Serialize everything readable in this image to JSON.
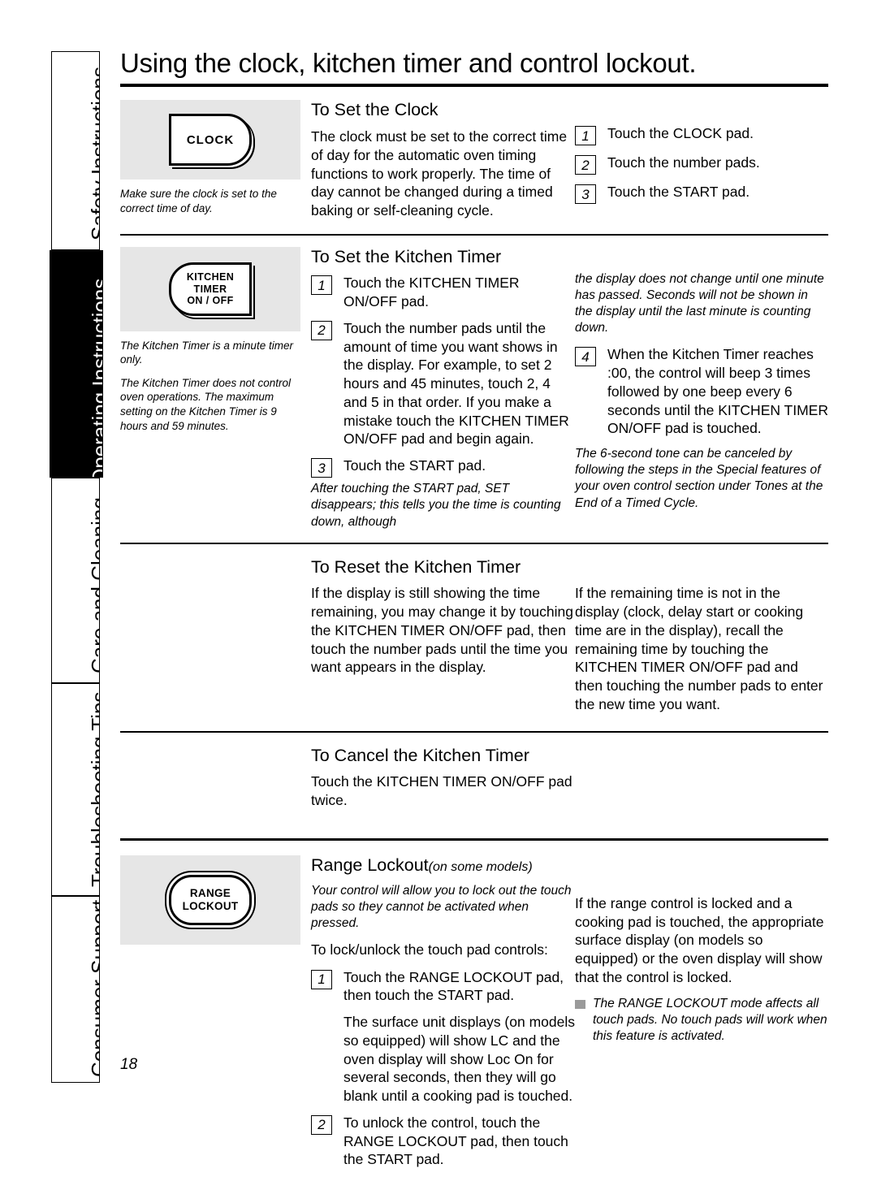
{
  "sidebar": {
    "tabs": [
      {
        "label": "Safety Instructions",
        "active": false
      },
      {
        "label": "Operating Instructions",
        "active": true
      },
      {
        "label": "Care and Cleaning",
        "active": false
      },
      {
        "label": "Troubleshooting Tips",
        "active": false
      },
      {
        "label": "Consumer Support",
        "active": false
      }
    ]
  },
  "page": {
    "title": "Using the clock, kitchen timer and control lockout.",
    "number": "18"
  },
  "clock_section": {
    "pad_label_line1": "CLOCK",
    "heading": "To Set the Clock",
    "caption": "Make sure the clock is set to the correct time of day.",
    "body": "The clock must be set to the correct time of day for the automatic oven timing functions to work properly. The time of day cannot be changed during a timed baking or self-cleaning cycle.",
    "steps": [
      {
        "num": "1",
        "text": "Touch the CLOCK pad."
      },
      {
        "num": "2",
        "text": "Touch the number pads."
      },
      {
        "num": "3",
        "text": "Touch the START pad."
      }
    ]
  },
  "set_timer_section": {
    "pad_label_line1": "KITCHEN",
    "pad_label_line2": "TIMER",
    "pad_label_line3": "ON / OFF",
    "heading": "To Set the Kitchen Timer",
    "caption1": "The Kitchen Timer is a minute timer only.",
    "caption2": "The Kitchen Timer does not control oven operations. The maximum setting on the Kitchen Timer is 9 hours and 59 minutes.",
    "steps": [
      {
        "num": "1",
        "text": "Touch the KITCHEN TIMER ON/OFF pad."
      },
      {
        "num": "2",
        "text": "Touch the number pads until the amount of time you want shows in the display. For example, to set 2 hours and 45 minutes, touch 2, 4 and 5 in that order. If you make a mistake touch the KITCHEN TIMER ON/OFF pad and begin again."
      },
      {
        "num": "3",
        "text": "Touch the START pad."
      }
    ],
    "note_after_step3": "After touching the START pad, SET disappears; this tells you the time is counting down, although",
    "note_continued": "the display does not change until one minute has passed. Seconds will not be shown in the display until the last minute is counting down.",
    "step4": {
      "num": "4",
      "text": "When the Kitchen Timer reaches :00, the control will beep 3 times followed by one beep every 6 seconds until the KITCHEN TIMER ON/OFF pad is touched."
    },
    "note_tone": "The 6-second tone can be canceled by following the steps in the Special features of your oven control section under Tones at the End of a Timed Cycle."
  },
  "reset_timer_section": {
    "heading": "To Reset the Kitchen Timer",
    "left_body": "If the display is still showing the time remaining, you may change it by touching the KITCHEN TIMER ON/OFF pad, then touch the number pads until the time you want appears in the display.",
    "right_body": "If the remaining time is not in the display (clock, delay start or cooking time are in the display), recall the remaining time by touching the KITCHEN TIMER ON/OFF pad and then touching the number pads to enter the new time you want."
  },
  "cancel_timer_section": {
    "heading": "To Cancel the Kitchen Timer",
    "body": "Touch the KITCHEN TIMER ON/OFF pad twice."
  },
  "lockout_section": {
    "pad_label_line1": "RANGE",
    "pad_label_line2": "LOCKOUT",
    "heading": "Range Lockout",
    "heading_sub": "(on some models)",
    "intro_italic": "Your control will allow you to lock out the touch pads so they cannot be activated when pressed.",
    "lead": "To lock/unlock the touch pad controls:",
    "steps": [
      {
        "num": "1",
        "text": "Touch the RANGE LOCKOUT pad, then touch the START pad."
      },
      {
        "num": "",
        "text": "The surface unit displays (on models so equipped) will show LC and the oven display will show Loc On for several seconds, then they will go blank until a cooking pad is touched."
      },
      {
        "num": "2",
        "text": "To unlock the control, touch the RANGE LOCKOUT pad, then touch the START pad."
      }
    ],
    "right_body": "If the range control is locked and a cooking pad is touched, the appropriate surface display (on models so equipped) or the oven display will show that the control is locked.",
    "bullet_note": "The RANGE LOCKOUT mode affects all touch pads. No touch pads will work when this feature is activated."
  }
}
